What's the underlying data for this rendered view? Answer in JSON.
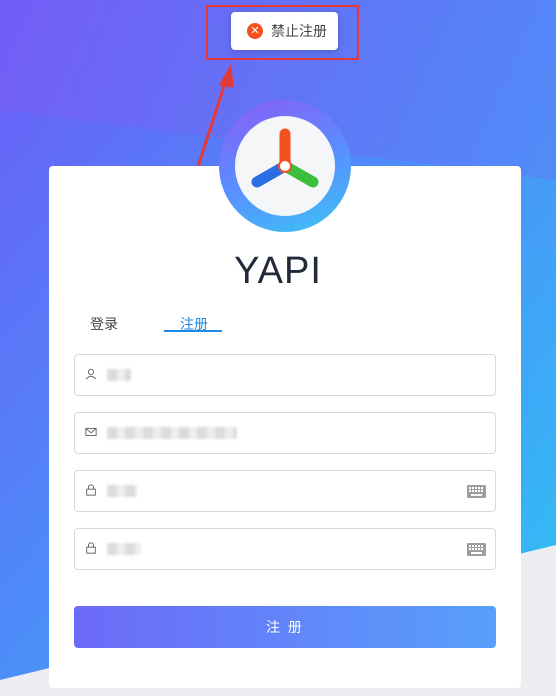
{
  "toast": {
    "message": "禁止注册",
    "icon": "close-circle-icon",
    "color": "#f4511e"
  },
  "annotation": {
    "box_color": "#e53935"
  },
  "app": {
    "title": "YAPI",
    "logo": "yapi-pinwheel-logo"
  },
  "tabs": [
    {
      "label": "登录",
      "active": false
    },
    {
      "label": "注册",
      "active": true
    }
  ],
  "form": {
    "username": {
      "icon": "user-icon",
      "value": ""
    },
    "email": {
      "icon": "mail-icon",
      "value": ""
    },
    "password": {
      "icon": "lock-icon",
      "value": ""
    },
    "confirm_password": {
      "icon": "lock-icon",
      "value": ""
    },
    "submit_label": "注 册"
  },
  "colors": {
    "accent": "#1e88e5",
    "button_start": "#6c6af8",
    "button_end": "#58a0fb"
  }
}
